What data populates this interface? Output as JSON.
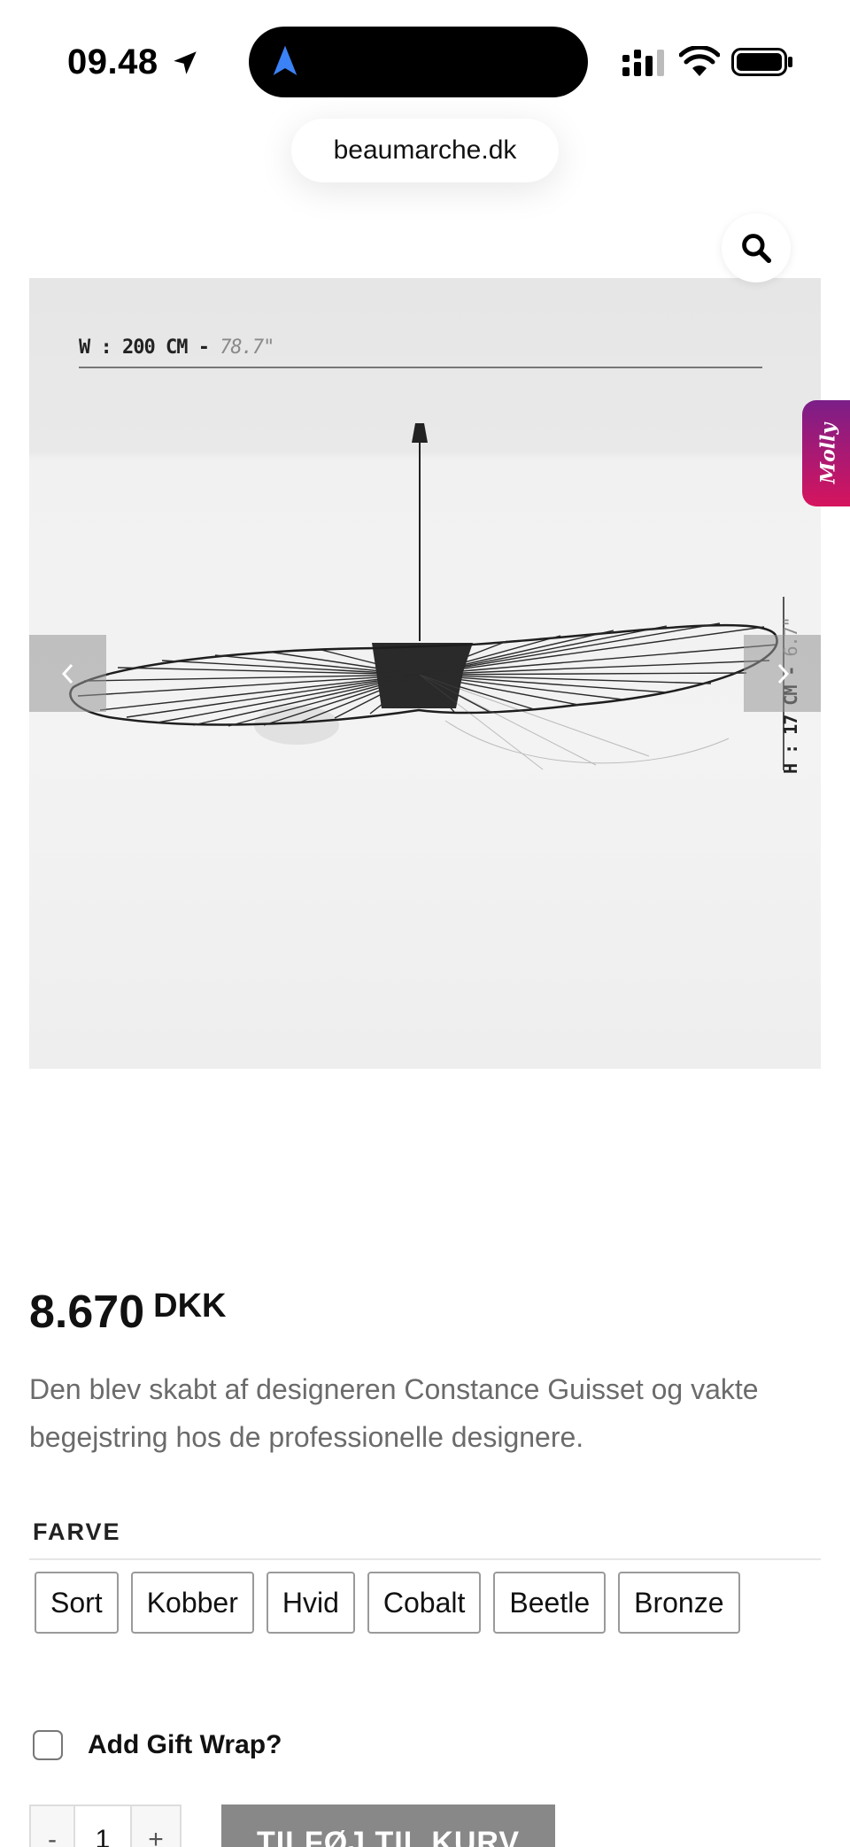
{
  "status_bar": {
    "time": "09.48",
    "icons": [
      "location-arrow-icon",
      "navigation-icon",
      "cellular-signal-icon",
      "wifi-icon",
      "battery-icon"
    ]
  },
  "browser": {
    "url": "beaumarche.dk"
  },
  "product_image": {
    "width_label": "W : 200 CM - ",
    "width_label_imperial": "78.7\"",
    "height_label": "H : 17 CM - ",
    "height_label_imperial": "6.7\"",
    "prev_icon": "chevron-left-icon",
    "next_icon": "chevron-right-icon",
    "search_icon": "search-icon"
  },
  "chat_widget": {
    "label": "Molly"
  },
  "product": {
    "price_amount": "8.670",
    "price_currency": "DKK",
    "description": "Den blev skabt af designeren Constance Guisset og vakte begejstring hos de professionelle designere.",
    "color_label": "FARVE",
    "colors": [
      "Sort",
      "Kobber",
      "Hvid",
      "Cobalt",
      "Beetle",
      "Bronze"
    ],
    "gift_wrap_label": "Add Gift Wrap?",
    "quantity_minus": "-",
    "quantity_value": "1",
    "quantity_plus": "+",
    "add_to_cart_label": "TILFØJ TIL KURV"
  },
  "colors": {
    "button_bg": "#888888",
    "chat_gradient_start": "#7b1e88",
    "chat_gradient_end": "#d6145e",
    "nav_accent": "#3b82f6"
  }
}
